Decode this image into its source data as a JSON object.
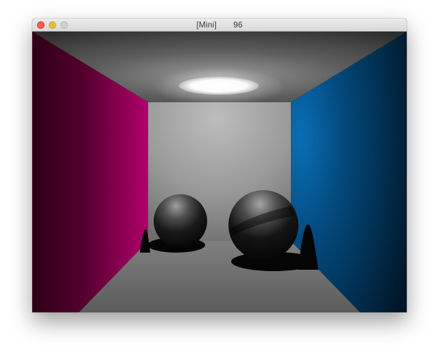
{
  "window": {
    "title": "[Mini]",
    "counter": "96"
  },
  "scene": {
    "colors": {
      "left_wall": "#b0006a",
      "right_wall": "#0a6fb5",
      "back_wall": "#b4b4b4",
      "floor": "#6e6e6e",
      "ceiling": "#5a5a5a",
      "light": "#ffffff",
      "spheres": "#0a0a0a"
    }
  }
}
